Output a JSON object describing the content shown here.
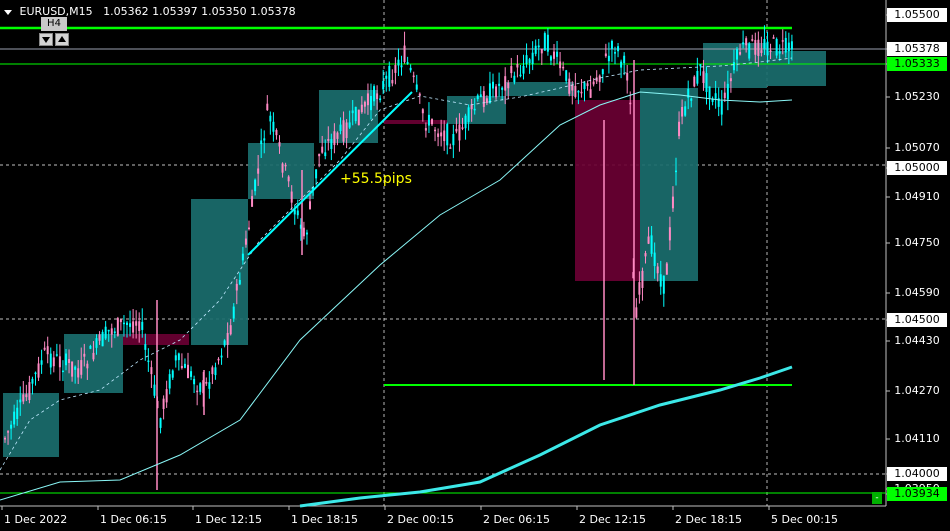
{
  "header": {
    "symbol_tf": "EURUSD,M15",
    "ohlc": "1.05362 1.05397 1.05350 1.05378"
  },
  "timeframe_control": {
    "label": "H4"
  },
  "annotation": {
    "text": "+55.5pips"
  },
  "price_axis": {
    "ticks": [
      "1.05500",
      "1.05378",
      "1.05333",
      "1.05230",
      "1.05070",
      "1.05000",
      "1.04910",
      "1.04750",
      "1.04590",
      "1.04500",
      "1.04430",
      "1.04270",
      "1.04110",
      "1.04000",
      "1.03950",
      "1.03934"
    ],
    "current_price": "1.05378",
    "level_labels": [
      "1.05500",
      "1.05333",
      "1.05000",
      "1.04500",
      "1.04000",
      "1.03934"
    ]
  },
  "time_axis": {
    "labels": [
      "1 Dec 2022",
      "1 Dec 06:15",
      "1 Dec 12:15",
      "1 Dec 18:15",
      "2 Dec 00:15",
      "2 Dec 06:15",
      "2 Dec 12:15",
      "2 Dec 18:15",
      "5 Dec 00:15"
    ]
  },
  "colors": {
    "background": "#000000",
    "bull_candle": "#00ffff",
    "bear_candle": "#ff8ac4",
    "htf_bull_box": "#1a6e6e",
    "htf_bear_box": "#6a0033",
    "level_line": "#00ff00",
    "ma_fast": "#8af7f7",
    "ma_slow": "#3ce8e8"
  }
}
